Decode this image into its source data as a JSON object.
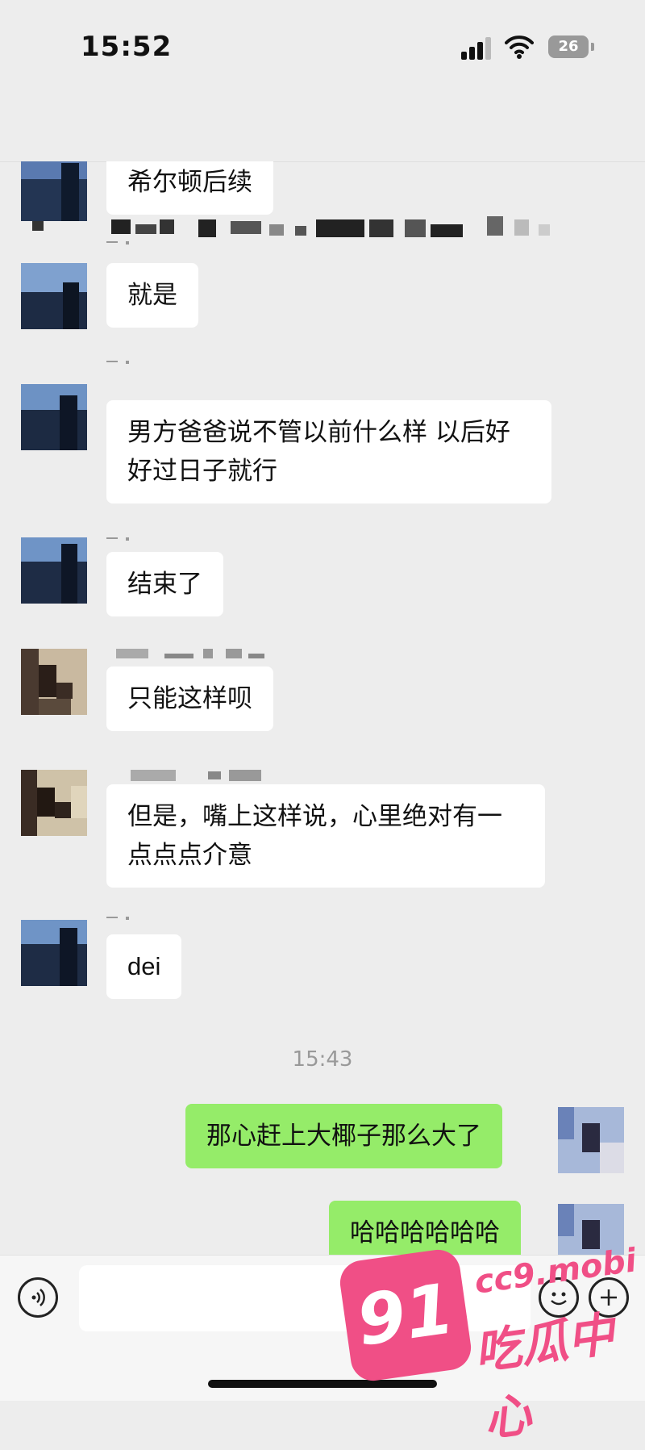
{
  "status_bar": {
    "time": "15:52",
    "battery": "26"
  },
  "chat": {
    "messages": [
      {
        "text": "希尔顿后续"
      },
      {
        "text": "就是"
      },
      {
        "text": "男方爸爸说不管以前什么样 以后好好过日子就行"
      },
      {
        "text": "结束了"
      },
      {
        "text": "只能这样呗"
      },
      {
        "text": "但是，嘴上这样说，心里绝对有一点点点介意"
      },
      {
        "text": "dei"
      },
      {
        "text": "那心赶上大椰子那么大了"
      },
      {
        "text": "哈哈哈哈哈哈"
      }
    ],
    "timestamp": "15:43"
  },
  "watermark": {
    "badge": "91",
    "site": "cc9.mobi",
    "name": "吃瓜中心"
  },
  "colors": {
    "background": "#ededed",
    "bubble_other": "#ffffff",
    "bubble_self": "#95ec69",
    "watermark": "#f04f86"
  }
}
